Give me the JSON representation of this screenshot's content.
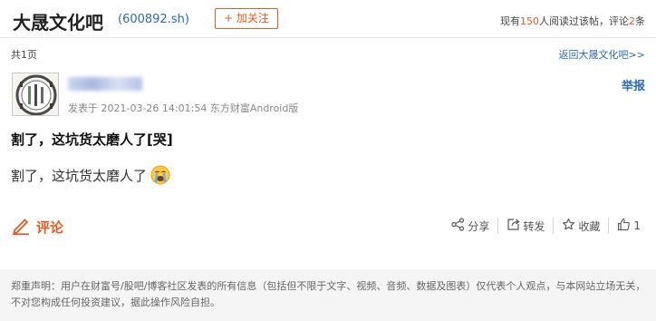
{
  "header": {
    "bar_title": "大晟文化吧",
    "stock_code": "(600892.sh)",
    "follow_label": "+ 加关注",
    "reader_prefix": "现有",
    "reader_count": "150",
    "reader_mid": "人阅读过该帖，评论",
    "comment_count": "2",
    "reader_suffix": "条"
  },
  "nav": {
    "pages": "共1页",
    "back_label": "返回大晟文化吧>>"
  },
  "post": {
    "time": "发表于 2021-03-26 14:01:54 东方财富Android版",
    "report_label": "举报",
    "title": "割了，这坑货太磨人了[哭]",
    "body": "割了，这坑货太磨人了",
    "emoji": "crying-face-icon"
  },
  "actions": {
    "comment_label": "评论",
    "share_label": "分享",
    "forward_label": "转发",
    "collect_label": "收藏",
    "like_count": "1"
  },
  "footer": {
    "disclaimer": "郑重声明：用户在财富号/股吧/博客社区发表的所有信息（包括但不限于文字、视频、音频、数据及图表）仅代表个人观点，与本网站立场无关，不对您构成任何投资建议，据此操作风险自担。"
  },
  "colors": {
    "accent": "#e9581f",
    "link": "#2a6ab4"
  }
}
